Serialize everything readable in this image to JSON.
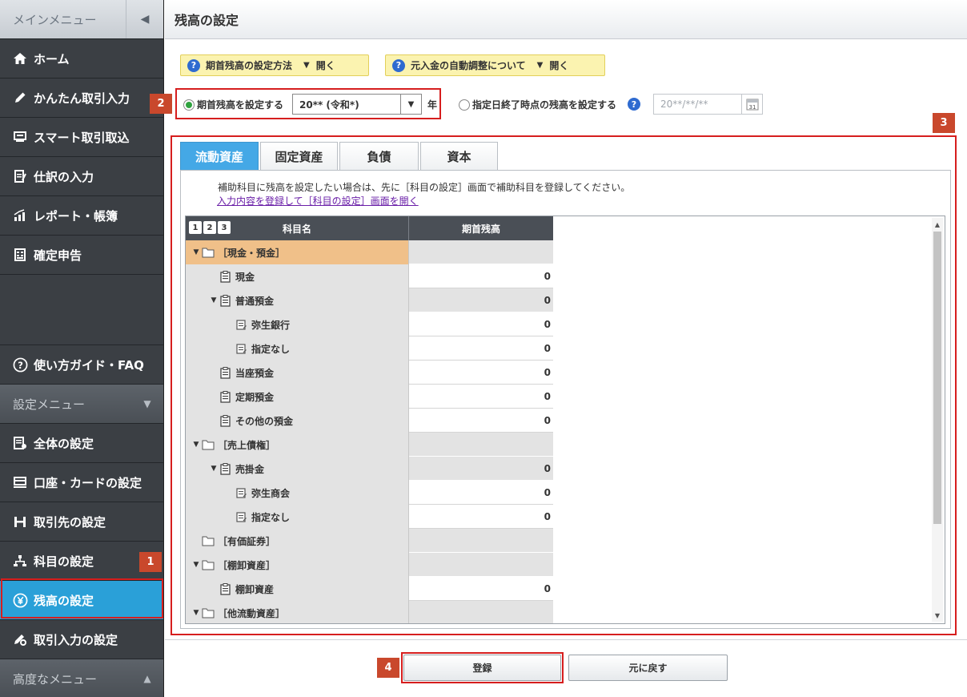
{
  "sidebar": {
    "main_menu_label": "メインメニュー",
    "items": [
      {
        "label": "ホーム",
        "icon": "home-icon"
      },
      {
        "label": "かんたん取引入力",
        "icon": "pencil-icon"
      },
      {
        "label": "スマート取引取込",
        "icon": "import-icon"
      },
      {
        "label": "仕訳の入力",
        "icon": "journal-icon"
      },
      {
        "label": "レポート・帳簿",
        "icon": "chart-icon"
      },
      {
        "label": "確定申告",
        "icon": "tax-return-icon"
      }
    ],
    "guide_label": "使い方ガイド・FAQ",
    "settings_menu_label": "設定メニュー",
    "settings_items": [
      {
        "label": "全体の設定",
        "icon": "settings-doc-icon"
      },
      {
        "label": "口座・カードの設定",
        "icon": "card-icon"
      },
      {
        "label": "取引先の設定",
        "icon": "partner-icon"
      },
      {
        "label": "科目の設定",
        "icon": "account-tree-icon"
      },
      {
        "label": "残高の設定",
        "icon": "yen-icon",
        "active": true
      },
      {
        "label": "取引入力の設定",
        "icon": "entry-settings-icon"
      }
    ],
    "advanced_menu_label": "高度なメニュー"
  },
  "header": {
    "title": "残高の設定"
  },
  "help": {
    "opening_balance_method": "期首残高の設定方法",
    "auto_adjust": "元入金の自動調整について",
    "open_label": "開く"
  },
  "options": {
    "set_opening_label": "期首残高を設定する",
    "year_value": "20** (令和*)",
    "year_suffix": "年",
    "set_end_date_label": "指定日終了時点の残高を設定する",
    "date_placeholder": "20**/**/**"
  },
  "tabs": [
    "流動資産",
    "固定資産",
    "負債",
    "資本"
  ],
  "notice": {
    "text": "補助科目に残高を設定したい場合は、先に［科目の設定］画面で補助科目を登録してください。",
    "link": "入力内容を登録して［科目の設定］画面を開く"
  },
  "grid": {
    "levels": [
      "1",
      "2",
      "3"
    ],
    "col_name": "科目名",
    "col_balance": "期首残高",
    "rows": [
      {
        "name": "［現金・預金］",
        "value": "",
        "type": "folder",
        "indent": 0,
        "expanded": true,
        "selected": true,
        "readonly": true
      },
      {
        "name": "現金",
        "value": "0",
        "type": "account",
        "indent": 1,
        "readonly": false
      },
      {
        "name": "普通預金",
        "value": "0",
        "type": "account",
        "indent": 1,
        "expanded": true,
        "readonly": true
      },
      {
        "name": "弥生銀行",
        "value": "0",
        "type": "sub",
        "indent": 2,
        "readonly": false
      },
      {
        "name": "指定なし",
        "value": "0",
        "type": "sub",
        "indent": 2,
        "readonly": false
      },
      {
        "name": "当座預金",
        "value": "0",
        "type": "account",
        "indent": 1,
        "readonly": false
      },
      {
        "name": "定期預金",
        "value": "0",
        "type": "account",
        "indent": 1,
        "readonly": false
      },
      {
        "name": "その他の預金",
        "value": "0",
        "type": "account",
        "indent": 1,
        "readonly": false
      },
      {
        "name": "［売上債権］",
        "value": "",
        "type": "folder",
        "indent": 0,
        "expanded": true,
        "readonly": true
      },
      {
        "name": "売掛金",
        "value": "0",
        "type": "account",
        "indent": 1,
        "expanded": true,
        "readonly": true
      },
      {
        "name": "弥生商会",
        "value": "0",
        "type": "sub",
        "indent": 2,
        "readonly": false
      },
      {
        "name": "指定なし",
        "value": "0",
        "type": "sub",
        "indent": 2,
        "readonly": false
      },
      {
        "name": "［有価証券］",
        "value": "",
        "type": "folder",
        "indent": 0,
        "readonly": true
      },
      {
        "name": "［棚卸資産］",
        "value": "",
        "type": "folder",
        "indent": 0,
        "expanded": true,
        "readonly": true
      },
      {
        "name": "棚卸資産",
        "value": "0",
        "type": "account",
        "indent": 1,
        "readonly": false
      },
      {
        "name": "［他流動資産］",
        "value": "",
        "type": "folder",
        "indent": 0,
        "expanded": true,
        "readonly": true
      }
    ]
  },
  "buttons": {
    "register": "登録",
    "back": "元に戻す"
  },
  "callouts": [
    "1",
    "2",
    "3",
    "4"
  ],
  "colors": {
    "accent": "#2aa0d8",
    "tab_active": "#44a8e6",
    "callout_red": "#d61e1e",
    "callout_badge": "#c9482c",
    "selected_row": "#f0c089"
  }
}
